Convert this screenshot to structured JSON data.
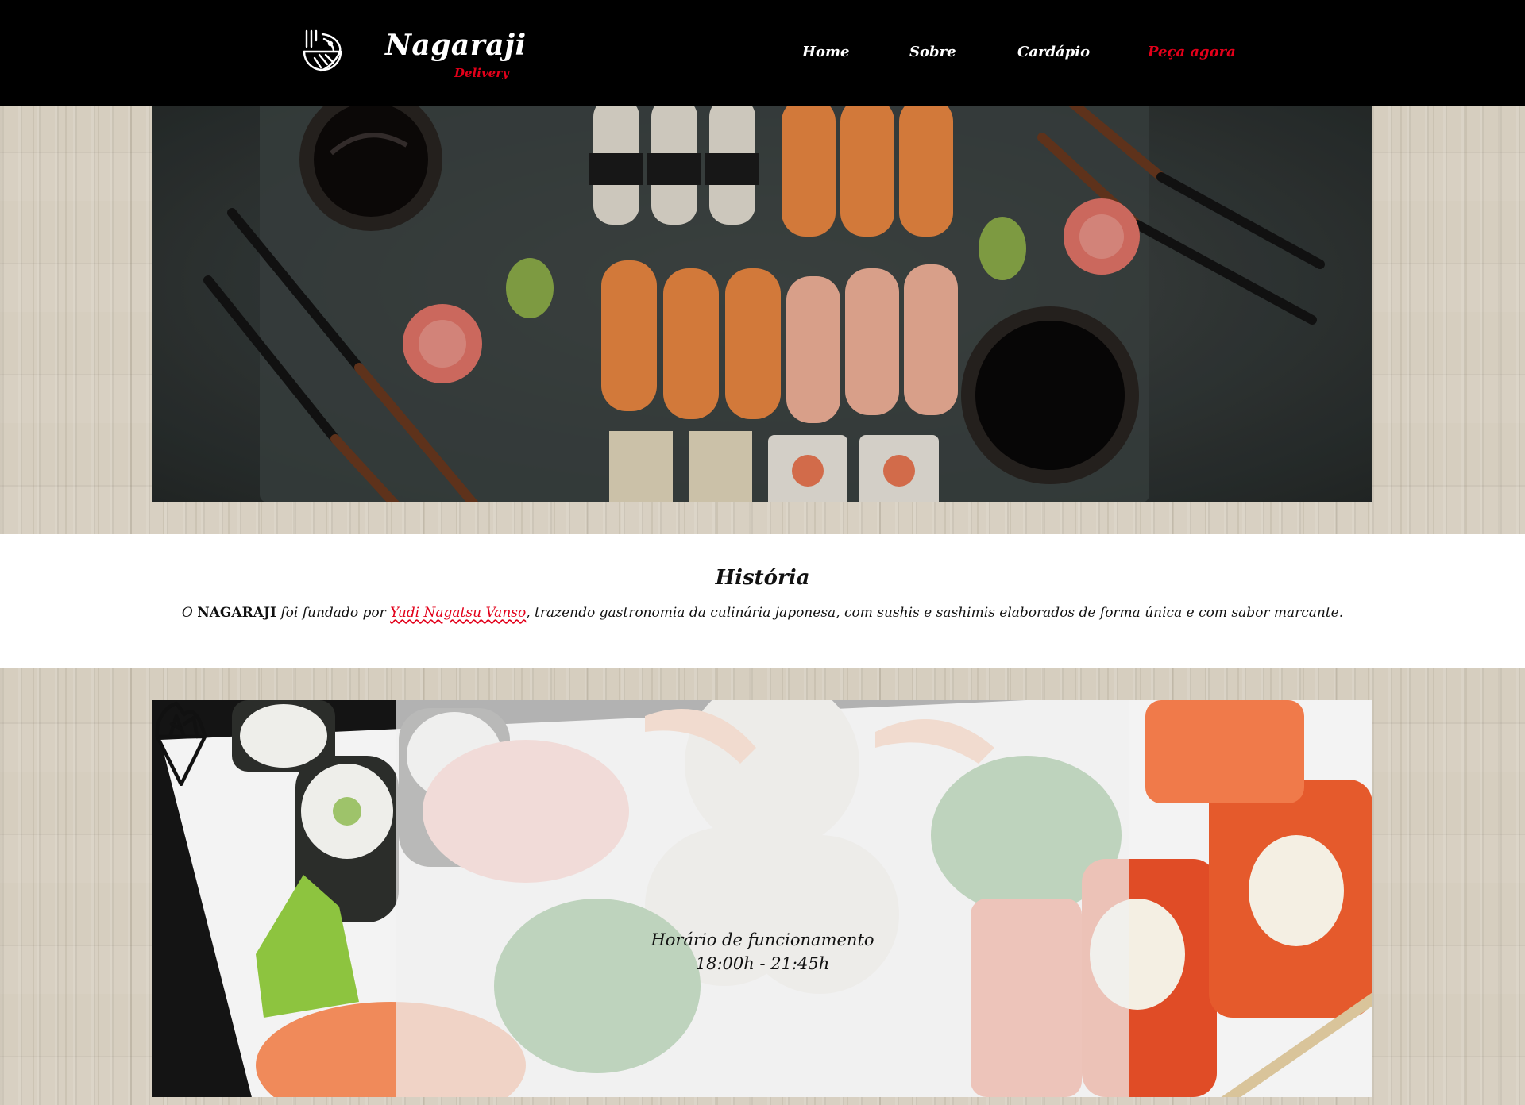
{
  "header": {
    "brand_name": "Nagaraji",
    "brand_sub": "Delivery",
    "nav": {
      "home": "Home",
      "sobre": "Sobre",
      "cardapio": "Cardápio",
      "peca_agora": "Peça agora"
    },
    "logo_icon": "fish-logo-icon"
  },
  "history": {
    "title": "História",
    "text_prefix": "O",
    "brand_bold": "NAGARAJI",
    "text_middle": "foi fundado por",
    "founder": "Yudi Nagatsu Vanso",
    "text_suffix": ", trazendo gastronomia da culinária japonesa, com sushis e sashimis elaborados de forma única e com sabor marcante."
  },
  "hours": {
    "label": "Horário de funcionamento",
    "value": "18:00h - 21:45h",
    "icon": "sushi-cone-icon"
  },
  "colors": {
    "accent": "#e2001a",
    "header_bg": "#000000",
    "wood": "#d6cebf"
  }
}
